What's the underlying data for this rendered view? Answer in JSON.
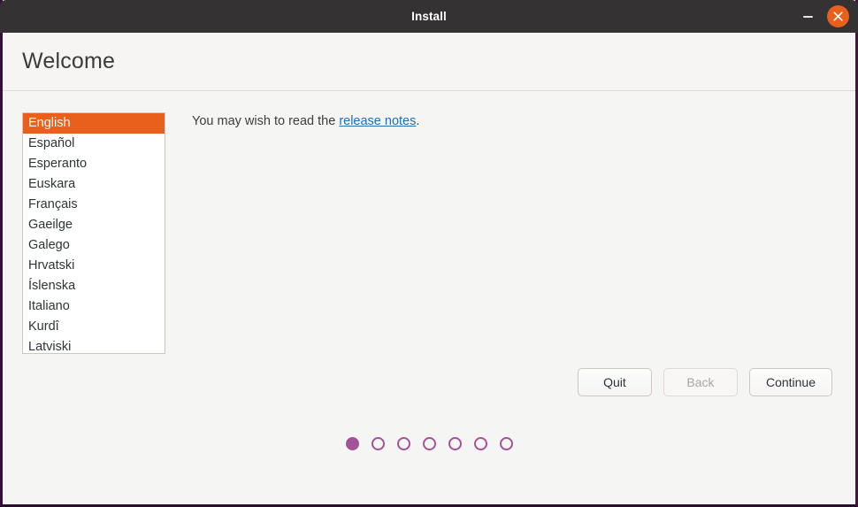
{
  "window": {
    "title": "Install",
    "titlebar_bg": "#353233",
    "border_color": "#35113a",
    "controls": {
      "minimize_label": "minimize",
      "close_label": "close",
      "close_bg": "#e8601c"
    }
  },
  "header": {
    "title": "Welcome"
  },
  "language_list": {
    "selected": "English",
    "accent_color": "#e8601c",
    "items": [
      "English",
      "Español",
      "Esperanto",
      "Euskara",
      "Français",
      "Gaeilge",
      "Galego",
      "Hrvatski",
      "Íslenska",
      "Italiano",
      "Kurdî",
      "Latviski"
    ]
  },
  "content": {
    "notes_prefix": "You may wish to read the ",
    "notes_link": "release notes",
    "notes_suffix": ".",
    "link_color": "#1c71b9"
  },
  "buttons": {
    "quit": "Quit",
    "back": "Back",
    "continue": "Continue"
  },
  "progress": {
    "total": 7,
    "current": 1,
    "dot_color": "#a6529a"
  }
}
